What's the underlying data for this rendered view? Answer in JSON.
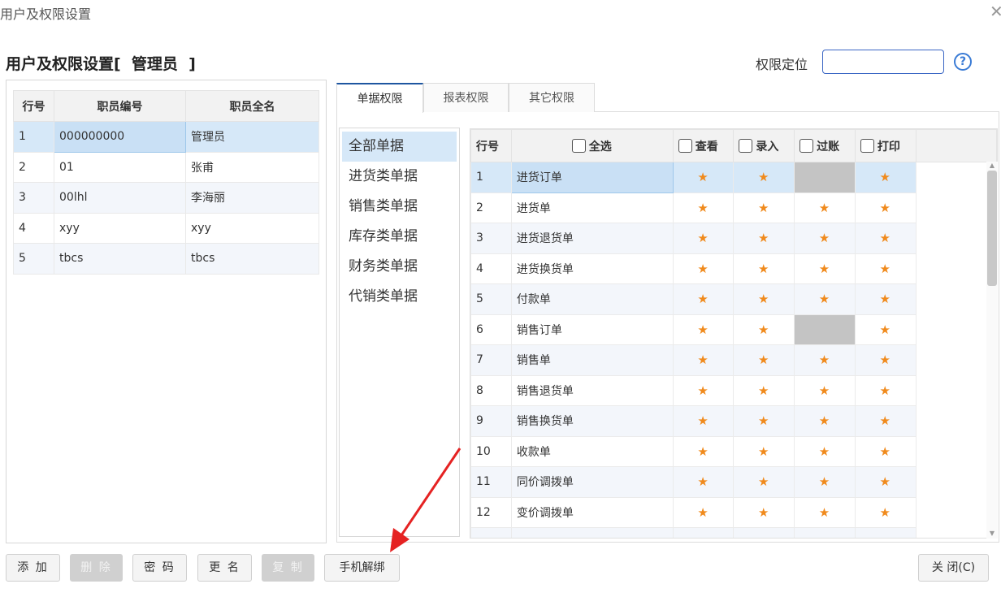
{
  "window": {
    "title": "用户及权限设置",
    "close_glyph": "✕"
  },
  "heading": "用户及权限设置[  管理员  ]",
  "locate": {
    "label": "权限定位",
    "value": ""
  },
  "help_glyph": "?",
  "user_table": {
    "headers": [
      "行号",
      "职员编号",
      "职员全名"
    ],
    "rows": [
      [
        "1",
        "000000000",
        "管理员"
      ],
      [
        "2",
        "01",
        "张甫"
      ],
      [
        "3",
        "00lhl",
        "李海丽"
      ],
      [
        "4",
        "xyy",
        "xyy"
      ],
      [
        "5",
        "tbcs",
        "tbcs"
      ]
    ]
  },
  "tabs": [
    "单据权限",
    "报表权限",
    "其它权限"
  ],
  "categories": [
    "全部单据",
    "进货类单据",
    "销售类单据",
    "库存类单据",
    "财务类单据",
    "代销类单据"
  ],
  "perm_table": {
    "headers": {
      "row": "行号",
      "select_all": "全选",
      "view": "查看",
      "entry": "录入",
      "post": "过账",
      "print": "打印"
    },
    "star": "★",
    "rows": [
      {
        "no": "1",
        "name": "进货订单"
      },
      {
        "no": "2",
        "name": "进货单"
      },
      {
        "no": "3",
        "name": "进货退货单"
      },
      {
        "no": "4",
        "name": "进货换货单"
      },
      {
        "no": "5",
        "name": "付款单"
      },
      {
        "no": "6",
        "name": "销售订单"
      },
      {
        "no": "7",
        "name": "销售单"
      },
      {
        "no": "8",
        "name": "销售退货单"
      },
      {
        "no": "9",
        "name": "销售换货单"
      },
      {
        "no": "10",
        "name": "收款单"
      },
      {
        "no": "11",
        "name": "同价调拨单"
      },
      {
        "no": "12",
        "name": "变价调拨单"
      }
    ]
  },
  "buttons": {
    "add": "添 加",
    "delete": "删 除",
    "password": "密 码",
    "rename": "更 名",
    "copy": "复 制",
    "unbind_phone": "手机解绑",
    "close": "关 闭(C)"
  },
  "colors": {
    "accent": "#1e56a0",
    "star": "#f08a1c",
    "selection": "#d6e8f8",
    "arrow": "#e52222"
  }
}
